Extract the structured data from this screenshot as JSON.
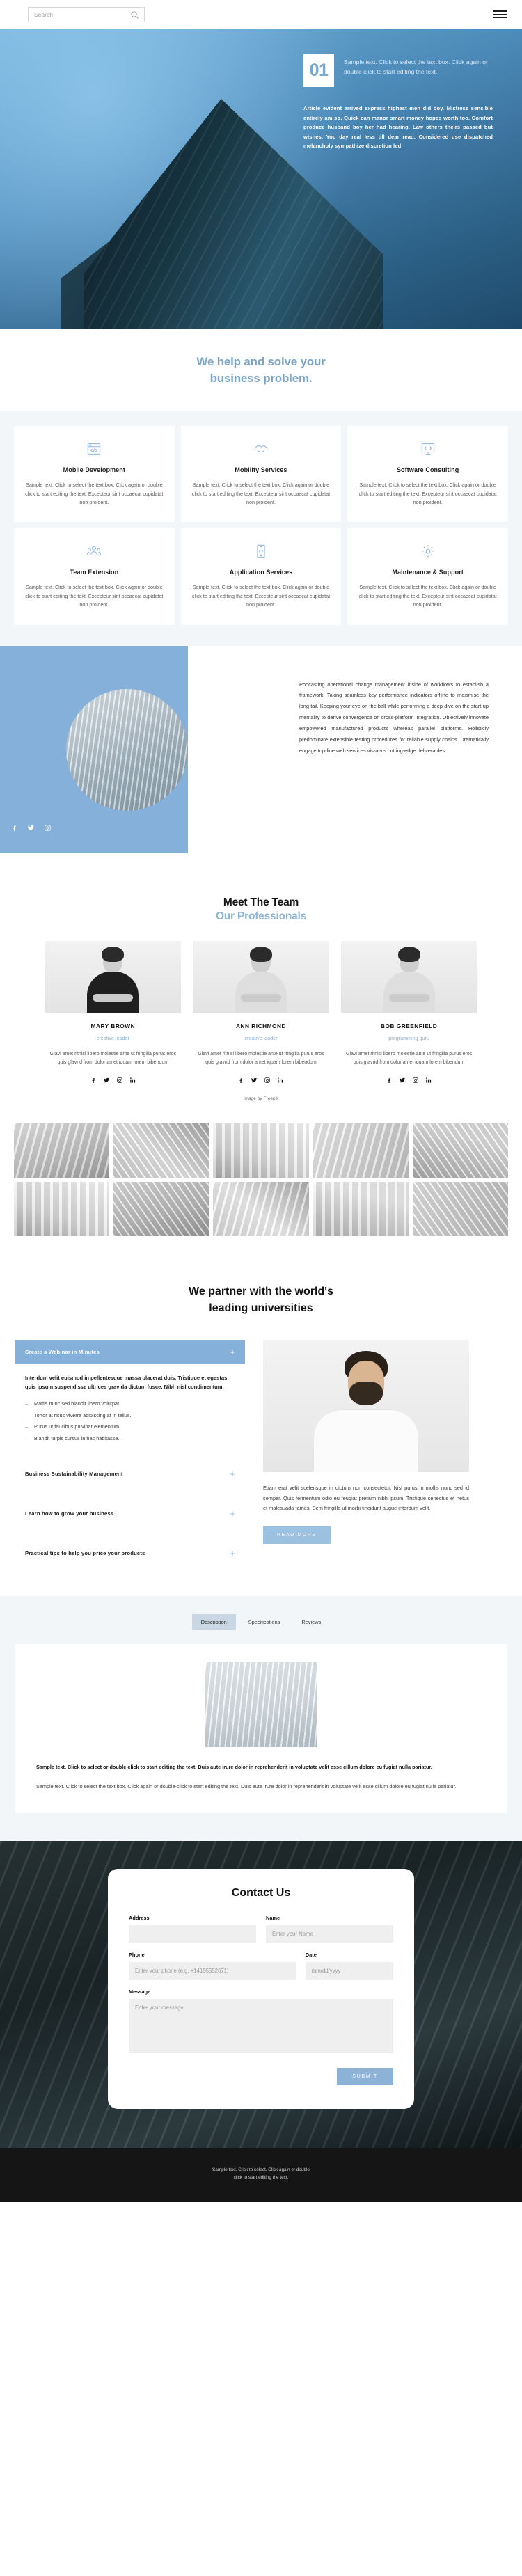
{
  "topbar": {
    "search_placeholder": "Search",
    "search_value": "",
    "search_icon": "search-icon",
    "menu_icon": "hamburger-menu-icon"
  },
  "hero": {
    "number": "01",
    "subtitle": "Sample text. Click to select the text box. Click again or double click to start editing the text.",
    "body": "Article evident arrived express highest men did boy. Mistress sensible entirely am so. Quick can manor smart money hopes worth too. Comfort produce husband boy her had hearing. Law others theirs passed but wishes. You day real less till dear read. Considered use dispatched melancholy sympathize discretion led."
  },
  "intro": {
    "heading_line1": "We help and solve your",
    "heading_line2": "business problem."
  },
  "services": [
    {
      "icon": "code-window-icon",
      "title": "Mobile Development",
      "text": "Sample text. Click to select the text box. Click again or double click to start editing the text. Excepteur sint occaecat cupidatat non proident."
    },
    {
      "icon": "handshake-icon",
      "title": "Mobility Services",
      "text": "Sample text. Click to select the text box. Click again or double click to start editing the text. Excepteur sint occaecat cupidatat non proident."
    },
    {
      "icon": "monitor-icon",
      "title": "Software Consulting",
      "text": "Sample text. Click to select the text box. Click again or double click to start editing the text. Excepteur sint occaecat cupidatat non proident."
    },
    {
      "icon": "people-group-icon",
      "title": "Team Extension",
      "text": "Sample text. Click to select the text box. Click again or double click to start editing the text. Excepteur sint occaecat cupidatat non proident."
    },
    {
      "icon": "mobile-phone-icon",
      "title": "Application Services",
      "text": "Sample text. Click to select the text box. Click again or double click to start editing the text. Excepteur sint occaecat cupidatat non proident."
    },
    {
      "icon": "gear-wrench-icon",
      "title": "Maintenance & Support",
      "text": "Sample text. Click to select the text box. Click again or double click to start editing the text. Excepteur sint occaecat cupidatat non proident."
    }
  ],
  "about": {
    "text": "Podcasting operational change management inside of workflows to establish a framework. Taking seamless key performance indicators offline to maximise the long tail. Keeping your eye on the ball while performing a deep dive on the start-up mentality to derive convergence on cross-platform integration. Objectively innovate empowered manufactured products whereas parallel platforms. Holisticly predominate extensible testing procedures for reliable supply chains. Dramatically engage top-line web services vis-a-vis cutting-edge deliverables.",
    "social": [
      "facebook-icon",
      "twitter-icon",
      "instagram-icon"
    ]
  },
  "team": {
    "heading_1": "Meet The Team",
    "heading_2": "Our Professionals",
    "credit": "Image by Freepik",
    "members": [
      {
        "name": "MARY BROWN",
        "role": "creative leader",
        "bio": "Glavi amet ritnisl libero molestie ante ut fringilla purus eros quis glavrid from dolor amet iquam lorem bibendum",
        "social": [
          "facebook-icon",
          "twitter-icon",
          "instagram-icon",
          "linkedin-icon"
        ]
      },
      {
        "name": "ANN RICHMOND",
        "role": "creative leader",
        "bio": "Glavi amet ritnisl libero molestie ante ut fringilla purus eros quis glavrid from dolor amet iquam lorem bibendum",
        "social": [
          "facebook-icon",
          "twitter-icon",
          "instagram-icon",
          "linkedin-icon"
        ]
      },
      {
        "name": "BOB GREENFIELD",
        "role": "programming guru",
        "bio": "Glavi amet ritnisl libero molestie ante ut fringilla purus eros quis glavrid from dolor amet iquam lorem bibendum",
        "social": [
          "facebook-icon",
          "twitter-icon",
          "instagram-icon",
          "linkedin-icon"
        ]
      }
    ]
  },
  "universities": {
    "heading_line1": "We partner with the world's",
    "heading_line2": "leading universities",
    "accordion": [
      {
        "title": "Create a Webinar in Minutes",
        "state": "open",
        "icon": "plus-icon",
        "lead": "Interdum velit euismod in pellentesque massa placerat duis. Tristique et egestas quis ipsum suspendisse ultrices gravida dictum fusce. Nibh nisl condimentum.",
        "bullets": [
          "Mattis nunc sed blandit libero volutpat.",
          "Tortor at risus viverra adipiscing at in tellus.",
          "Purus ut faucibus pulvinar elementum.",
          "Blandit turpis cursus in hac habitasse."
        ]
      },
      {
        "title": "Business Sustainability Management",
        "state": "closed",
        "icon": "plus-icon"
      },
      {
        "title": "Learn how to grow your business",
        "state": "closed",
        "icon": "plus-icon"
      },
      {
        "title": "Practical tips to help you price your products",
        "state": "closed",
        "icon": "plus-icon"
      }
    ],
    "copy": "Etiam erat velit scelerisque in dictum non consectetur. Nisl purus in mollis nunc sed id semper. Quis fermentum odio eu feugiat pretium nibh ipsum. Tristique senectus et netus et malesuada fames. Sem fringilla ut morbi tincidunt augue interdum velit.",
    "read_more": "READ MORE"
  },
  "tabs": {
    "items": [
      {
        "label": "Description",
        "active": true
      },
      {
        "label": "Specifications",
        "active": false
      },
      {
        "label": "Reviews",
        "active": false
      }
    ],
    "panel_bold": "Sample text. Click to select or double click to start editing the text. Duis aute irure dolor in reprehenderit in voluptate velit esse cillum dolore eu fugiat nulla pariatur.",
    "panel_text": "Sample text. Click to select the text box. Click again or double-click to start editing the text. Duis aute irure dolor in reprehenderit in voluptate velit esse cillum dolore eu fugiat nulla pariatur."
  },
  "contact": {
    "title": "Contact Us",
    "fields": {
      "address_label": "Address",
      "address_placeholder": "",
      "address_value": "",
      "name_label": "Name",
      "name_placeholder": "Enter your Name",
      "name_value": "",
      "phone_label": "Phone",
      "phone_placeholder": "Enter your phone (e.g. +14155552671)",
      "phone_value": "",
      "date_label": "Date",
      "date_placeholder": "mm/dd/yyyy",
      "date_value": "",
      "message_label": "Message",
      "message_placeholder": "Enter your message",
      "message_value": ""
    },
    "submit_label": "SUBMIT"
  },
  "footer": {
    "line1": "Sample text. Click to select. Click again or double",
    "line2": "click to start editing the text."
  },
  "colors": {
    "accent_blue": "#85b0da",
    "heading_blue": "#7da5c7",
    "hero_blue": "#3f7fae",
    "panel_grey": "#f3f6f9",
    "dark": "#151515"
  }
}
